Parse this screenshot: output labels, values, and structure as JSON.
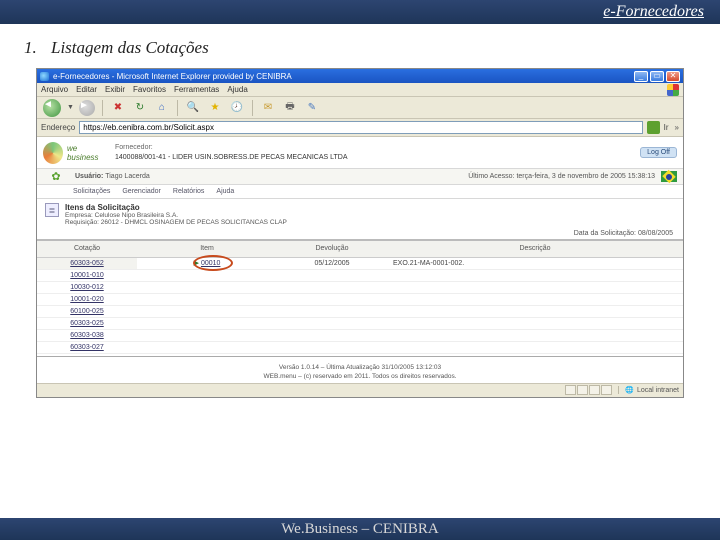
{
  "slide": {
    "header": "e-Fornecedores",
    "section_num": "1.",
    "section_title": "Listagem das Cotações",
    "footer": "We.Business – CENIBRA"
  },
  "browser": {
    "title": "e-Fornecedores - Microsoft Internet Explorer provided by CENIBRA",
    "menu": {
      "arquivo": "Arquivo",
      "editar": "Editar",
      "exibir": "Exibir",
      "favoritos": "Favoritos",
      "ferramentas": "Ferramentas",
      "ajuda": "Ajuda"
    },
    "address_label": "Endereço",
    "address_value": "https://eb.cenibra.com.br/Solicit.aspx",
    "go_label": "Ir",
    "status_zone": "Local intranet"
  },
  "wb": {
    "logo_text": "we business",
    "forn_label": "Fornecedor:",
    "forn_value": "1400088/001-41 - LIDER USIN.SOBRESS.DE PECAS MECANICAS LTDA",
    "user_label": "Usuário:",
    "user_value": "Tiago Lacerda",
    "last_label": "Último Acesso:",
    "last_value": "terça-feira, 3 de novembro de 2005 15:38:13",
    "logoff": "Log Off",
    "menu": {
      "solic": "Solicitações",
      "ger": "Gerenciador",
      "rel": "Relatórios",
      "ajuda": "Ajuda"
    }
  },
  "itens": {
    "title": "Itens da Solicitação",
    "emp_label": "Empresa:",
    "emp_value": "Celulose Nipo Brasileira S.A.",
    "req_label": "Requisição:",
    "req_value": "26012 - DHMCL OSINAGEM DE PECAS SOLICITANCAS CLAP",
    "date_label": "Data da Solicitação:",
    "date_value": "08/08/2005"
  },
  "table": {
    "headers": {
      "cotacao": "Cotação",
      "item": "Item",
      "devolucao": "Devolução",
      "descricao": "Descrição"
    },
    "rows": [
      {
        "cot": "60303-052",
        "item": "00010",
        "dev": "05/12/2005",
        "desc": "EXO.21-MA-0001-002."
      },
      {
        "cot": "10001-010"
      },
      {
        "cot": "10030-012"
      },
      {
        "cot": "10001-020"
      },
      {
        "cot": "60100-025"
      },
      {
        "cot": "60303-025"
      },
      {
        "cot": "60303-038"
      },
      {
        "cot": "60303-027"
      }
    ]
  },
  "footer_app": {
    "line1": "Versão 1.0.14 – Última Atualização 31/10/2005 13:12:03",
    "line2": "WEB.menu – (c) reservado em 2011. Todos os direitos reservados."
  }
}
